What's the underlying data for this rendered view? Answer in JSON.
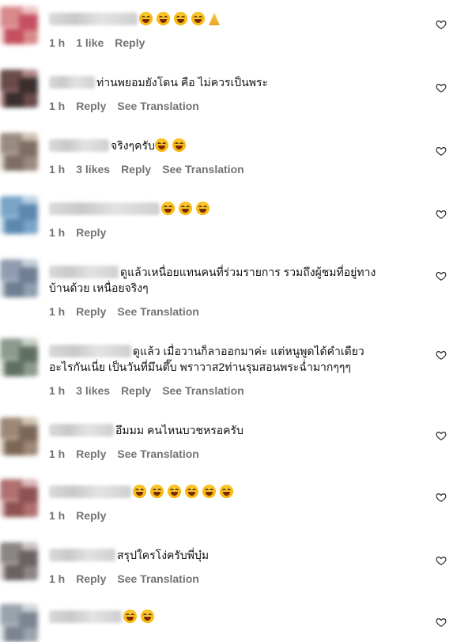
{
  "comments": [
    {
      "name_w": 112,
      "text": "",
      "emojis": [
        "laugh",
        "laugh",
        "laugh",
        "laugh",
        "pray"
      ],
      "time": "1 h",
      "likes": "1 like",
      "reply": "Reply",
      "translate": ""
    },
    {
      "name_w": 58,
      "text": "ท่านพยอมยังโดน คือ ไม่ควรเป็นพระ",
      "emojis": [],
      "time": "1 h",
      "likes": "",
      "reply": "Reply",
      "translate": "See Translation"
    },
    {
      "name_w": 76,
      "text": "จริงๆครับ",
      "emojis": [
        "laugh",
        "cool"
      ],
      "time": "1 h",
      "likes": "3 likes",
      "reply": "Reply",
      "translate": "See Translation"
    },
    {
      "name_w": 140,
      "text": "",
      "emojis": [
        "laugh",
        "laugh",
        "laugh"
      ],
      "time": "1 h",
      "likes": "",
      "reply": "Reply",
      "translate": ""
    },
    {
      "name_w": 88,
      "text": "ดูแล้วเหนื่อยแทนคนที่ร่วมรายการ รวมถึงผู้ชมที่อยู่ทาง",
      "text2": "บ้านด้วย เหนื่อยจริงๆ",
      "emojis": [],
      "time": "1 h",
      "likes": "",
      "reply": "Reply",
      "translate": "See Translation"
    },
    {
      "name_w": 104,
      "text": "ดูแล้ว เมื่อวานก็ลาออกมาค่ะ แต่หนูพูดได้คำเดียว",
      "text2": "อะไรกันเนี่ย เป็นวันที่มึนตึ๊บ พราวาส2ท่านรุมสอนพระฉ่ำมากๆๆๆ",
      "emojis": [],
      "time": "1 h",
      "likes": "3 likes",
      "reply": "Reply",
      "translate": "See Translation"
    },
    {
      "name_w": 82,
      "text": "อึมมม คนไหนบวชหรอครับ",
      "emojis": [],
      "time": "1 h",
      "likes": "",
      "reply": "Reply",
      "translate": "See Translation"
    },
    {
      "name_w": 104,
      "text": "",
      "emojis": [
        "laugh",
        "laugh",
        "laugh",
        "laugh",
        "laugh",
        "laugh"
      ],
      "time": "1 h",
      "likes": "",
      "reply": "Reply",
      "translate": ""
    },
    {
      "name_w": 84,
      "text": "สรุปใครโง่ครับพี่บุ๋ม",
      "emojis": [],
      "time": "1 h",
      "likes": "",
      "reply": "Reply",
      "translate": "See Translation"
    },
    {
      "name_w": 92,
      "text": "",
      "emojis": [
        "laugh",
        "laugh"
      ],
      "time": "",
      "likes": "",
      "reply": "",
      "translate": ""
    }
  ],
  "colors": {
    "meta": "#737373",
    "text": "#111111"
  },
  "icons": {
    "like": "heart-outline-icon"
  }
}
